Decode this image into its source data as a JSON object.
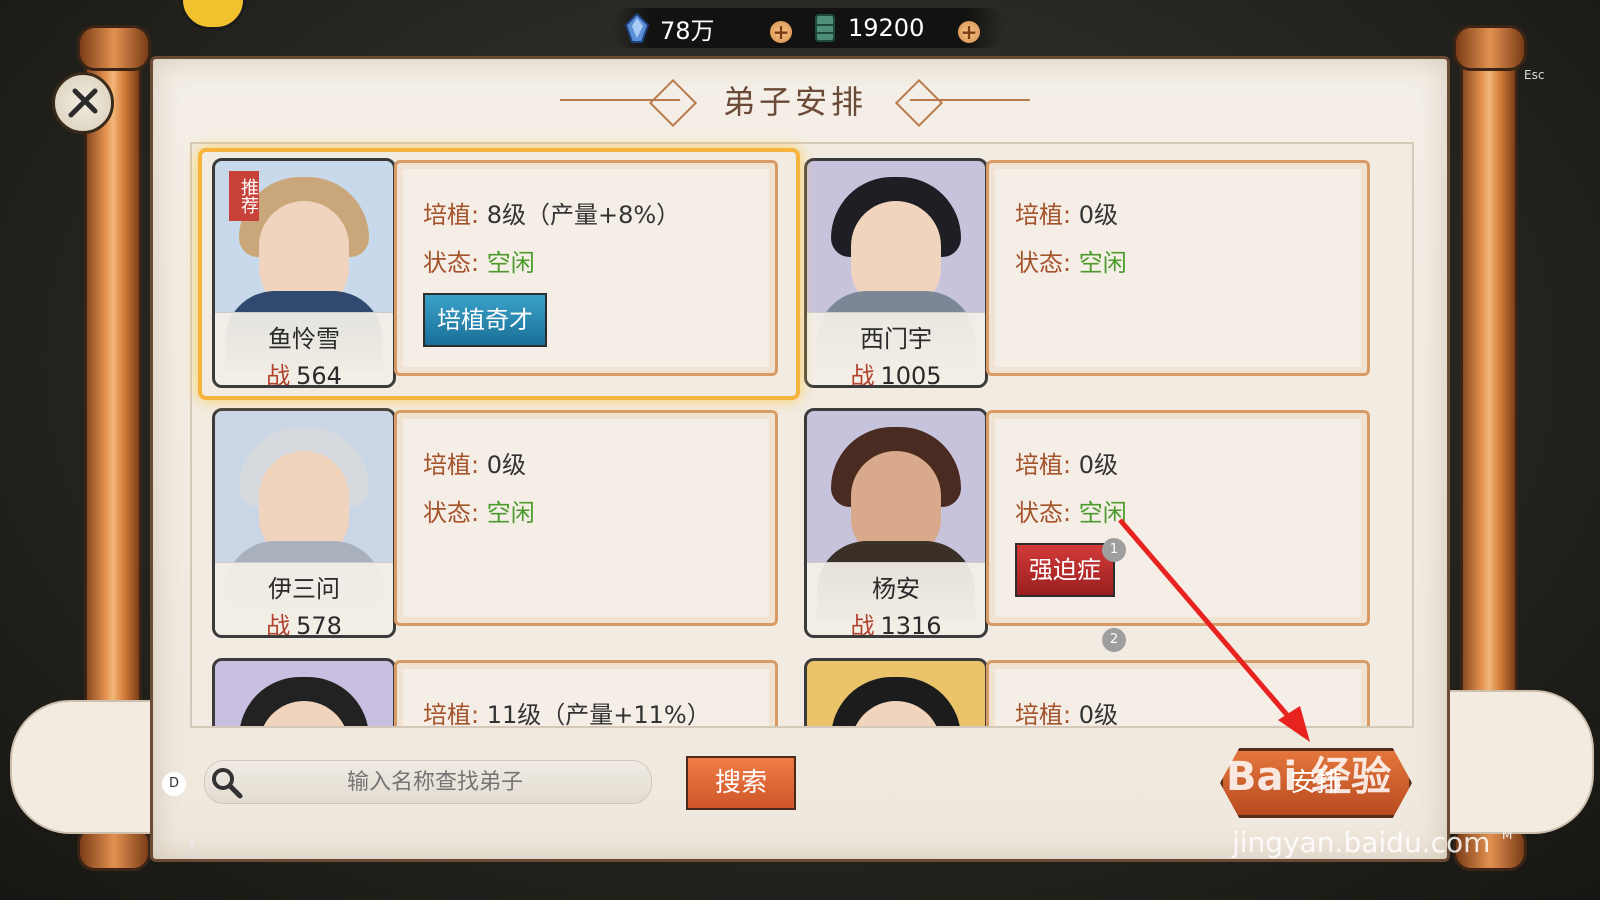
{
  "currency": {
    "spirit_stone": "78万",
    "bamboo": "19200"
  },
  "title": "弟子安排",
  "keys": {
    "esc": "Esc",
    "x": "X",
    "m": "M",
    "d": "D"
  },
  "recommend_badge": "推荐",
  "disciples": [
    {
      "name": "鱼怜雪",
      "power": "564",
      "cultivate_label": "培植:",
      "cultivate": "8级（产量+8%）",
      "status_label": "状态:",
      "status": "空闲",
      "tag": "培植奇才",
      "tag_color": "blue",
      "recommended": true
    },
    {
      "name": "西门宇",
      "power": "1005",
      "cultivate_label": "培植:",
      "cultivate": "0级",
      "status_label": "状态:",
      "status": "空闲"
    },
    {
      "name": "伊三问",
      "power": "578",
      "cultivate_label": "培植:",
      "cultivate": "0级",
      "status_label": "状态:",
      "status": "空闲"
    },
    {
      "name": "杨安",
      "power": "1316",
      "cultivate_label": "培植:",
      "cultivate": "0级",
      "status_label": "状态:",
      "status": "空闲",
      "tag": "强迫症",
      "tag_color": "red"
    },
    {
      "name": "",
      "power": "",
      "cultivate_label": "培植:",
      "cultivate": "11级（产量+11%）"
    },
    {
      "name": "",
      "power": "",
      "cultivate_label": "培植:",
      "cultivate": "0级"
    }
  ],
  "power_prefix": "战",
  "badges": [
    "1",
    "2"
  ],
  "search": {
    "placeholder": "输入名称查找弟子",
    "button": "搜索"
  },
  "arrange_button": "安排",
  "watermark": {
    "brand": "Bai 经验",
    "url": "jingyan.baidu.com"
  },
  "colors": {
    "accent_orange": "#d0562a",
    "status_green": "#4b9a2a",
    "label_brown": "#a4532a",
    "highlight_gold": "#f7b43c"
  }
}
